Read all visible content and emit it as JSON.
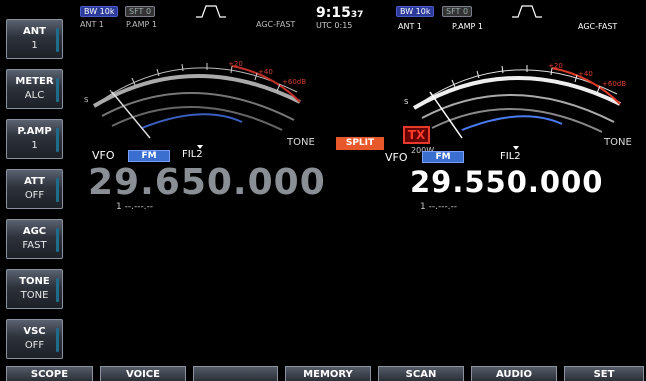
{
  "left_keys": [
    {
      "label": "ANT",
      "value": "1"
    },
    {
      "label": "METER",
      "value": "ALC"
    },
    {
      "label": "P.AMP",
      "value": "1"
    },
    {
      "label": "ATT",
      "value": "OFF"
    },
    {
      "label": "AGC",
      "value": "FAST"
    },
    {
      "label": "TONE",
      "value": "TONE"
    },
    {
      "label": "VSC",
      "value": "OFF"
    }
  ],
  "bottom_keys": [
    "SCOPE",
    "VOICE",
    "",
    "MEMORY",
    "SCAN",
    "AUDIO",
    "SET"
  ],
  "main_vfo": {
    "bw": "BW 10k",
    "sft": "SFT 0",
    "ant": "ANT 1",
    "pamp": "P.AMP 1",
    "agc": "AGC-FAST",
    "vfo_label": "VFO",
    "mode": "FM",
    "filter": "FIL2",
    "frequency": "29.650.000",
    "memory": "1 --.---.--",
    "tone": "TONE"
  },
  "sub_vfo": {
    "bw": "BW 10k",
    "sft": "SFT 0",
    "ant": "ANT 1",
    "pamp": "P.AMP 1",
    "agc": "AGC-FAST",
    "vfo_label": "VFO",
    "mode": "FM",
    "filter": "FIL2",
    "frequency": "29.550.000",
    "memory": "1 --.---.--",
    "tone": "TONE"
  },
  "clock": {
    "hm": "9:15",
    "sec": "37",
    "utc": "UTC  0:15"
  },
  "split_label": "SPLIT",
  "tx_label": "TX",
  "power": "200W",
  "colors": {
    "split": "#e8582a",
    "tx": "#e83a2a",
    "mode": "#3a6fd0",
    "meter_red": "#d0302a",
    "meter_blue": "#3a6fd0"
  }
}
